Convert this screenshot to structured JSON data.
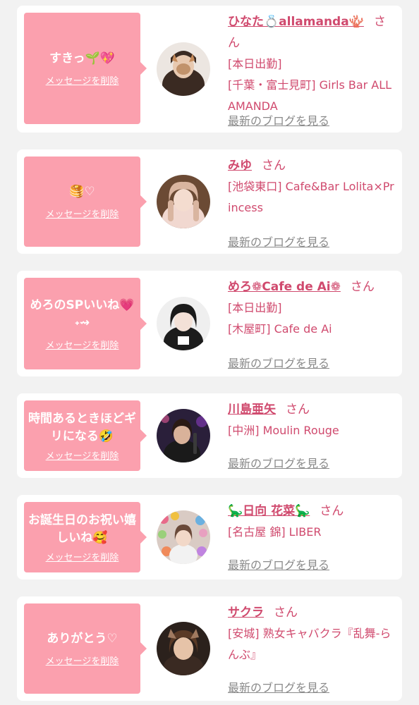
{
  "labels": {
    "delete_message": "メッセージを削除",
    "view_blog": "最新のブログを見る",
    "honorific": "さん"
  },
  "colors": {
    "accent": "#d04a6e",
    "bubble": "#fba0ae",
    "background": "#f2f2f2",
    "muted": "#8a8a8a"
  },
  "messages": [
    {
      "message": "すきっ🌱💖",
      "name": "ひなた💍allamanda🪸",
      "shop": "[本日出勤]\n[千葉・富士見町] Girls Bar ALLAMANDA",
      "avatar_icon": "profile-photo-icon"
    },
    {
      "message": "🥞♡",
      "name": "みゆ",
      "shop": "[池袋東口] Cafe&Bar Lolita×Princess",
      "avatar_icon": "profile-photo-icon"
    },
    {
      "message": "めろのSPいいね💗˖⇝",
      "name": "めろ❁Cafe de Ai❁",
      "shop": "[本日出勤]\n[木屋町] Cafe de Ai",
      "avatar_icon": "profile-photo-icon"
    },
    {
      "message": "時間あるときほどギリになる🤣",
      "name": "川島亜矢",
      "shop": "[中洲] Moulin Rouge",
      "avatar_icon": "profile-photo-icon"
    },
    {
      "message": "お誕生日のお祝い嬉しいね🥰",
      "name": "🦕日向 花菜🦕",
      "shop": "[名古屋 錦] LIBER",
      "avatar_icon": "profile-photo-icon"
    },
    {
      "message": "ありがとう♡",
      "name": "サクラ",
      "shop": "[安城] 熟女キャバクラ『乱舞-らんぶ』",
      "avatar_icon": "profile-photo-icon"
    }
  ]
}
